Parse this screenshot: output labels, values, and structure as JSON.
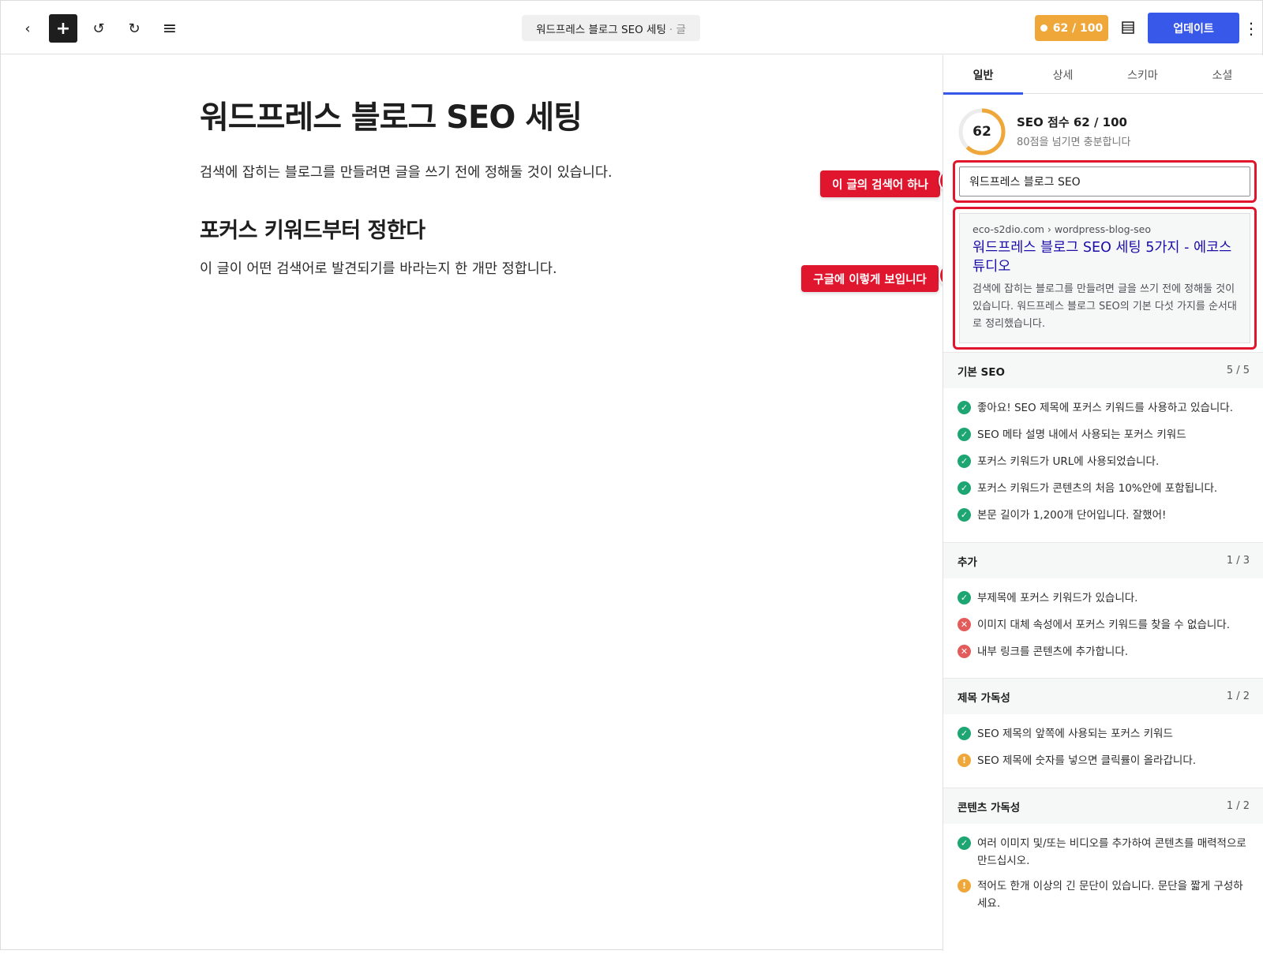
{
  "topbar": {
    "back_icon": "‹",
    "add_icon": "+",
    "undo_icon": "↺",
    "redo_icon": "↻",
    "list_icon": "≡",
    "doc_title": "워드프레스 블로그 SEO 세팅",
    "doc_type": "· 글",
    "score_label": "62 / 100",
    "update_label": "업데이트",
    "more_icon": "⋮",
    "score_color": "#f0a73a",
    "update_color": "#3858e9"
  },
  "editor": {
    "title": "워드프레스 블로그 SEO 세팅",
    "paragraph1": "검색에 잡히는 블로그를 만들려면 글을 쓰기 전에 정해둘 것이 있습니다.",
    "heading2": "포커스 키워드부터 정한다",
    "paragraph2": "이 글이 어떤 검색어로 발견되기를 바라는지 한 개만 정합니다."
  },
  "callouts": [
    {
      "label": "이 글의 검색어 하나",
      "number": "2"
    },
    {
      "label": "구글에 이렇게 보입니다",
      "number": "3"
    }
  ],
  "sidebar": {
    "tabs": [
      {
        "label": "일반",
        "active": true
      },
      {
        "label": "상세",
        "active": false
      },
      {
        "label": "스키마",
        "active": false
      },
      {
        "label": "소셜",
        "active": false
      }
    ],
    "score": {
      "value": "62",
      "fraction": 0.62,
      "title": "SEO 점수 62 / 100",
      "subtitle": "80점을 넘기면 충분합니다"
    },
    "focus_keyword": "워드프레스 블로그 SEO",
    "serp": {
      "url": "eco-s2dio.com › wordpress-blog-seo",
      "title": "워드프레스 블로그 SEO 세팅 5가지 - 에코스튜디오",
      "description": "검색에 잡히는 블로그를 만들려면 글을 쓰기 전에 정해둘 것이 있습니다. 워드프레스 블로그 SEO의 기본 다섯 가지를 순서대로 정리했습니다."
    },
    "sections": [
      {
        "title": "기본 SEO",
        "count": "5 / 5",
        "items": [
          {
            "status": "ok",
            "text": "좋아요! SEO 제목에 포커스 키워드를 사용하고 있습니다."
          },
          {
            "status": "ok",
            "text": "SEO 메타 설명 내에서 사용되는 포커스 키워드"
          },
          {
            "status": "ok",
            "text": "포커스 키워드가 URL에 사용되었습니다."
          },
          {
            "status": "ok",
            "text": "포커스 키워드가 콘텐츠의 처음 10%안에 포함됩니다."
          },
          {
            "status": "ok",
            "text": "본문 길이가 1,200개 단어입니다. 잘했어!"
          }
        ]
      },
      {
        "title": "추가",
        "count": "1 / 3",
        "items": [
          {
            "status": "ok",
            "text": "부제목에 포커스 키워드가 있습니다."
          },
          {
            "status": "bad",
            "text": "이미지 대체 속성에서 포커스 키워드를 찾을 수 없습니다."
          },
          {
            "status": "bad",
            "text": "내부 링크를 콘텐츠에 추가합니다."
          }
        ]
      },
      {
        "title": "제목 가독성",
        "count": "1 / 2",
        "items": [
          {
            "status": "ok",
            "text": "SEO 제목의 앞쪽에 사용되는 포커스 키워드"
          },
          {
            "status": "warn",
            "text": "SEO 제목에 숫자를 넣으면 클릭률이 올라갑니다."
          }
        ]
      },
      {
        "title": "콘텐츠 가독성",
        "count": "1 / 2",
        "items": [
          {
            "status": "ok",
            "text": "여러 이미지 및/또는 비디오를 추가하여 콘텐츠를 매력적으로 만드십시오."
          },
          {
            "status": "warn",
            "text": "적어도 한개 이상의 긴 문단이 있습니다. 문단을 짧게 구성하세요."
          }
        ]
      }
    ],
    "status_colors": {
      "ok": "#1ea672",
      "bad": "#e35b5b",
      "warn": "#f0a73a"
    }
  }
}
